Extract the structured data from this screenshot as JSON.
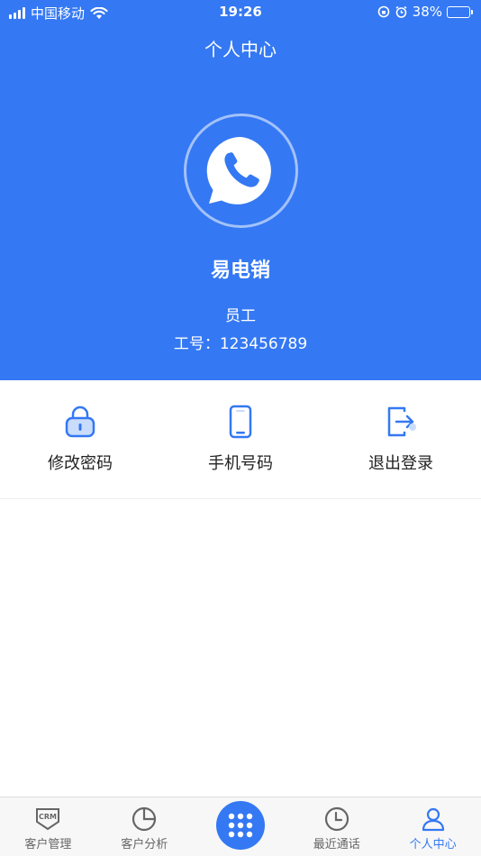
{
  "status_bar": {
    "carrier": "中国移动",
    "time": "19:26",
    "battery": "38%",
    "battery_level": 0.38
  },
  "header": {
    "title": "个人中心",
    "company_name": "易电销",
    "role": "员工",
    "employee_id": "工号：123456789"
  },
  "actions": [
    {
      "label": "修改密码",
      "icon": "lock-icon"
    },
    {
      "label": "手机号码",
      "icon": "phone-icon"
    },
    {
      "label": "退出登录",
      "icon": "logout-icon"
    }
  ],
  "tabbar": {
    "items": [
      {
        "label": "客户管理",
        "icon": "crm-icon"
      },
      {
        "label": "客户分析",
        "icon": "pie-chart-icon"
      },
      {
        "label": "",
        "icon": "dialpad-icon"
      },
      {
        "label": "最近通话",
        "icon": "clock-icon"
      },
      {
        "label": "个人中心",
        "icon": "user-icon"
      }
    ],
    "active_index": 4
  },
  "colors": {
    "primary": "#3478f3",
    "tab_inactive": "#666666",
    "icon_light": "#c9dcfb"
  }
}
